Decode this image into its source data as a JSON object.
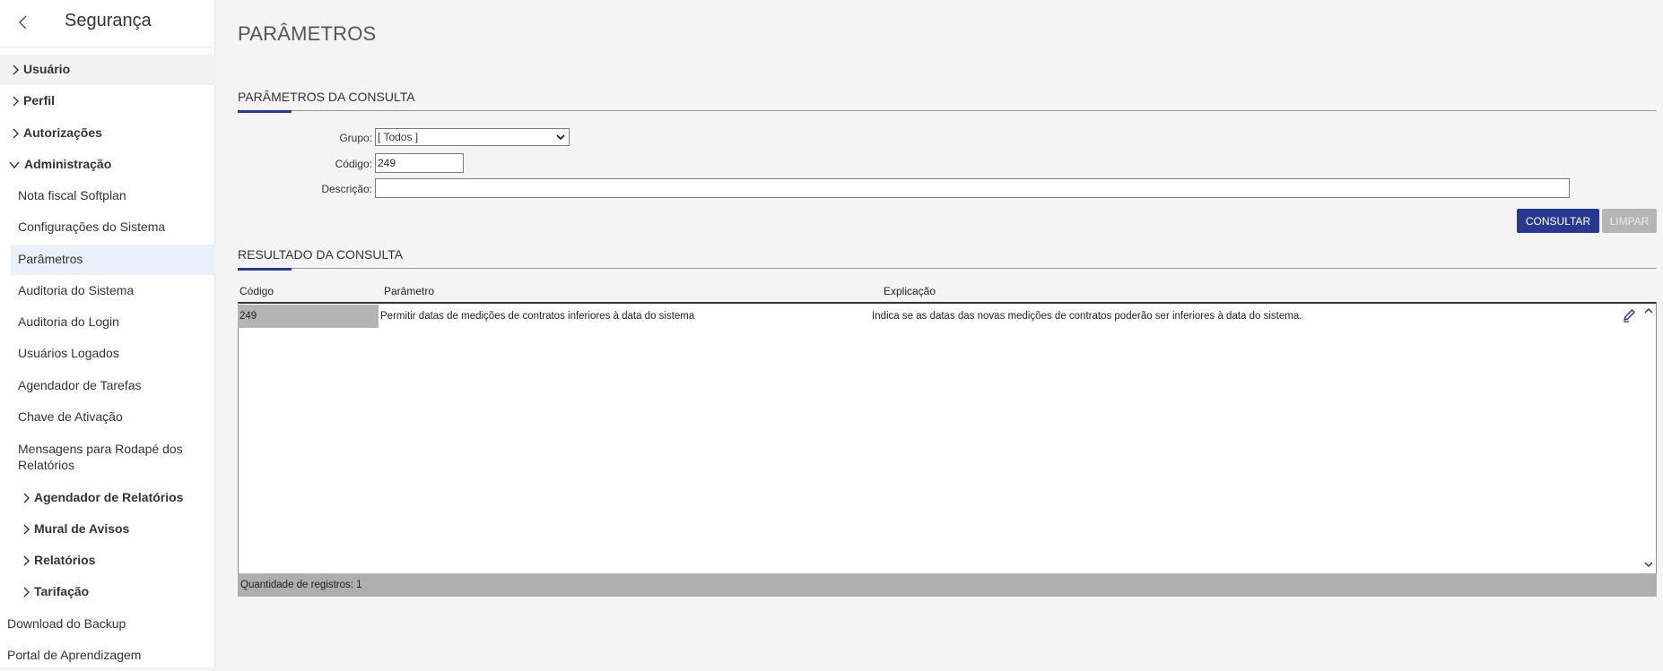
{
  "sidebar": {
    "title": "Segurança",
    "items": [
      {
        "label": "Usuário"
      },
      {
        "label": "Perfil"
      },
      {
        "label": "Autorizações"
      },
      {
        "label": "Administração"
      },
      {
        "label": "Nota fiscal Softplan"
      },
      {
        "label": "Configurações do Sistema"
      },
      {
        "label": "Parâmetros"
      },
      {
        "label": "Auditoria do Sistema"
      },
      {
        "label": "Auditoria do Login"
      },
      {
        "label": "Usuários Logados"
      },
      {
        "label": "Agendador de Tarefas"
      },
      {
        "label": "Chave de Ativação"
      },
      {
        "label": "Mensagens para Rodapé dos Relatórios"
      },
      {
        "label": "Agendador de Relatórios"
      },
      {
        "label": "Mural de Avisos"
      },
      {
        "label": "Relatórios"
      },
      {
        "label": "Tarifação"
      },
      {
        "label": "Download do Backup"
      },
      {
        "label": "Portal de Aprendizagem"
      }
    ]
  },
  "page": {
    "title": "PARÂMETROS"
  },
  "query": {
    "section_title": "PARÂMETROS DA CONSULTA",
    "grupo_label": "Grupo:",
    "grupo_value": "[ Todos ]",
    "codigo_label": "Código:",
    "codigo_value": "249",
    "descricao_label": "Descrição:",
    "descricao_value": "",
    "consultar_label": "CONSULTAR",
    "limpar_label": "LIMPAR"
  },
  "results": {
    "section_title": "RESULTADO DA CONSULTA",
    "columns": [
      "Código",
      "Parâmetro",
      "Explicação"
    ],
    "rows": [
      {
        "codigo": "249",
        "parametro": "Permitir datas de medições de contratos inferiores à data do sistema",
        "explicacao": "Indica se as datas das novas medições de contratos poderão ser inferiores à data do sistema."
      }
    ],
    "footer": "Quantidade de registros: 1"
  },
  "colors": {
    "accent": "#283a8f",
    "disabled": "#b5b5b5"
  },
  "icons": {
    "back": "chevron-left-icon",
    "collapsed": "chevron-right-icon",
    "expanded": "chevron-down-icon",
    "edit": "pencil-icon"
  }
}
